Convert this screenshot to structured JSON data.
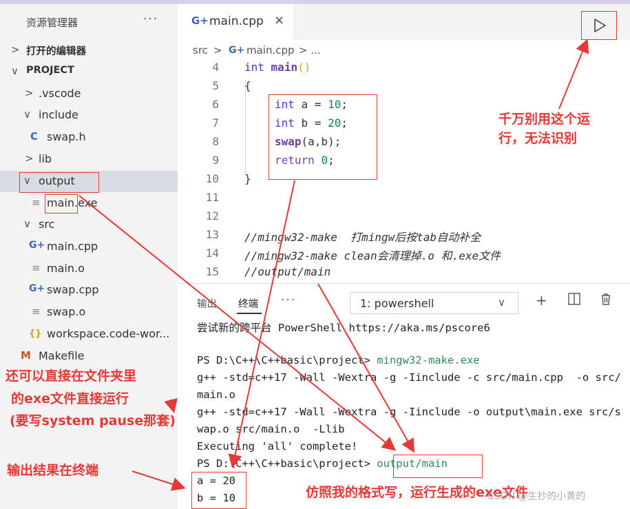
{
  "sidebar": {
    "title": "资源管理器",
    "more": "···",
    "open_editors": "打开的编辑器",
    "project": "PROJECT",
    "items": [
      {
        "label": ".vscode",
        "icon": "chevron-right-icon"
      },
      {
        "label": "include",
        "icon": "chevron-down-icon"
      },
      {
        "label": "swap.h",
        "icon": "c-header-icon",
        "glyph": "C"
      },
      {
        "label": "lib",
        "icon": "chevron-right-icon"
      },
      {
        "label": "output",
        "icon": "chevron-down-icon"
      },
      {
        "label": "main.exe",
        "icon": "file-lines-icon",
        "glyph": "≡"
      },
      {
        "label": "src",
        "icon": "chevron-down-icon"
      },
      {
        "label": "main.cpp",
        "icon": "cpp-file-icon",
        "glyph": "G+"
      },
      {
        "label": "main.o",
        "icon": "file-lines-icon",
        "glyph": "≡"
      },
      {
        "label": "swap.cpp",
        "icon": "cpp-file-icon",
        "glyph": "G+"
      },
      {
        "label": "swap.o",
        "icon": "file-lines-icon",
        "glyph": "≡"
      },
      {
        "label": "workspace.code-wor...",
        "icon": "json-braces-icon",
        "glyph": "{}"
      },
      {
        "label": "Makefile",
        "icon": "makefile-icon",
        "glyph": "M"
      }
    ]
  },
  "editor": {
    "tab_label": "main.cpp",
    "tab_icon": "G+",
    "tab_close": "×",
    "breadcrumb": [
      "src",
      ">",
      "main.cpp",
      "> ..."
    ],
    "code_lines": [
      {
        "n": "4",
        "text": "int main()"
      },
      {
        "n": "5",
        "text": "{"
      },
      {
        "n": "6",
        "text": "int a = 10;"
      },
      {
        "n": "7",
        "text": "int b = 20;"
      },
      {
        "n": "8",
        "text": "swap(a,b);"
      },
      {
        "n": "9",
        "text": "return 0;"
      },
      {
        "n": "10",
        "text": "}"
      },
      {
        "n": "11",
        "text": ""
      },
      {
        "n": "12",
        "text": ""
      },
      {
        "n": "13",
        "text": "//mingw32-make  打mingw后按tab自动补全"
      },
      {
        "n": "14",
        "text": "//mingw32-make clean会清理掉.o 和.exe文件"
      },
      {
        "n": "15",
        "text": "//output/main"
      }
    ]
  },
  "panel": {
    "tab_output": "输出",
    "tab_terminal": "终端",
    "more": "···",
    "shell": "1: powershell",
    "terminal_lines": [
      "尝试新的跨平台 PowerShell https://aka.ms/pscore6",
      "",
      "PS D:\\C++\\C++basic\\project> ",
      "g++ -std=c++17 -Wall -Wextra -g -Iinclude -c src/main.cpp  -o src/",
      "main.o",
      "g++ -std=c++17 -Wall -Wextra -g -Iinclude -o output\\main.exe src/s",
      "wap.o src/main.o  -Llib",
      "Executing 'all' complete!",
      "PS D:\\C++\\C++basic\\project> ",
      "a = 20",
      "b = 10"
    ],
    "cmd_make": "mingw32-make.exe",
    "cmd_run": "output/main"
  },
  "annotations": {
    "run_warning_line1": "千万别用这个运",
    "run_warning_line2": "行，无法识别",
    "folder_run_line1": "还可以直接在文件夹里",
    "folder_run_line2": "的exe文件直接运行",
    "folder_run_line3": "(要写system pause那套)",
    "output_note": "输出结果在终端",
    "format_note": "仿照我的格式写，运行生成的exe文件"
  },
  "watermark": "CSDN @生抄的小黄的",
  "colors": {
    "annotation": "#e53935",
    "accent": "#3e66c0"
  }
}
